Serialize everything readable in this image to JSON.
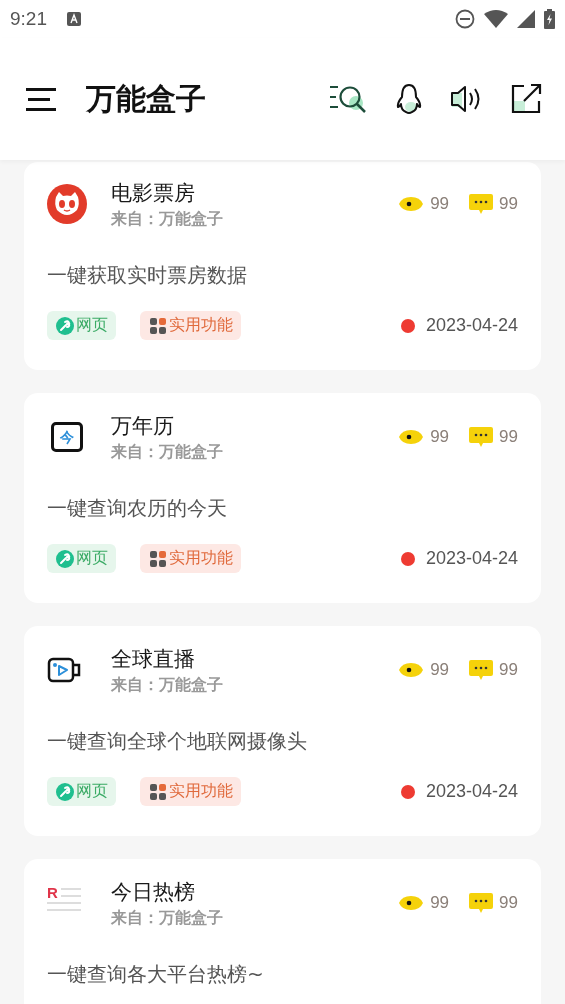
{
  "status_bar": {
    "time": "9:21"
  },
  "app_bar": {
    "title": "万能盒子"
  },
  "items": [
    {
      "kind": "cat",
      "title": "电影票房",
      "source": "来自：万能盒子",
      "views": "99",
      "comments": "99",
      "description": "一键获取实时票房数据",
      "tags": [
        {
          "kind": "web",
          "label": "网页"
        },
        {
          "kind": "util",
          "label": "实用功能"
        }
      ],
      "date": "2023-04-24"
    },
    {
      "kind": "calendar",
      "icon_text": "今",
      "title": "万年历",
      "source": "来自：万能盒子",
      "views": "99",
      "comments": "99",
      "description": "一键查询农历的今天",
      "tags": [
        {
          "kind": "web",
          "label": "网页"
        },
        {
          "kind": "util",
          "label": "实用功能"
        }
      ],
      "date": "2023-04-24"
    },
    {
      "kind": "camera",
      "title": "全球直播",
      "source": "来自：万能盒子",
      "views": "99",
      "comments": "99",
      "description": "一键查询全球个地联网摄像头",
      "tags": [
        {
          "kind": "web",
          "label": "网页"
        },
        {
          "kind": "util",
          "label": "实用功能"
        }
      ],
      "date": "2023-04-24"
    },
    {
      "kind": "list",
      "icon_text": "R",
      "title": "今日热榜",
      "source": "来自：万能盒子",
      "views": "99",
      "comments": "99",
      "description": "一键查询各大平台热榜~"
    }
  ]
}
